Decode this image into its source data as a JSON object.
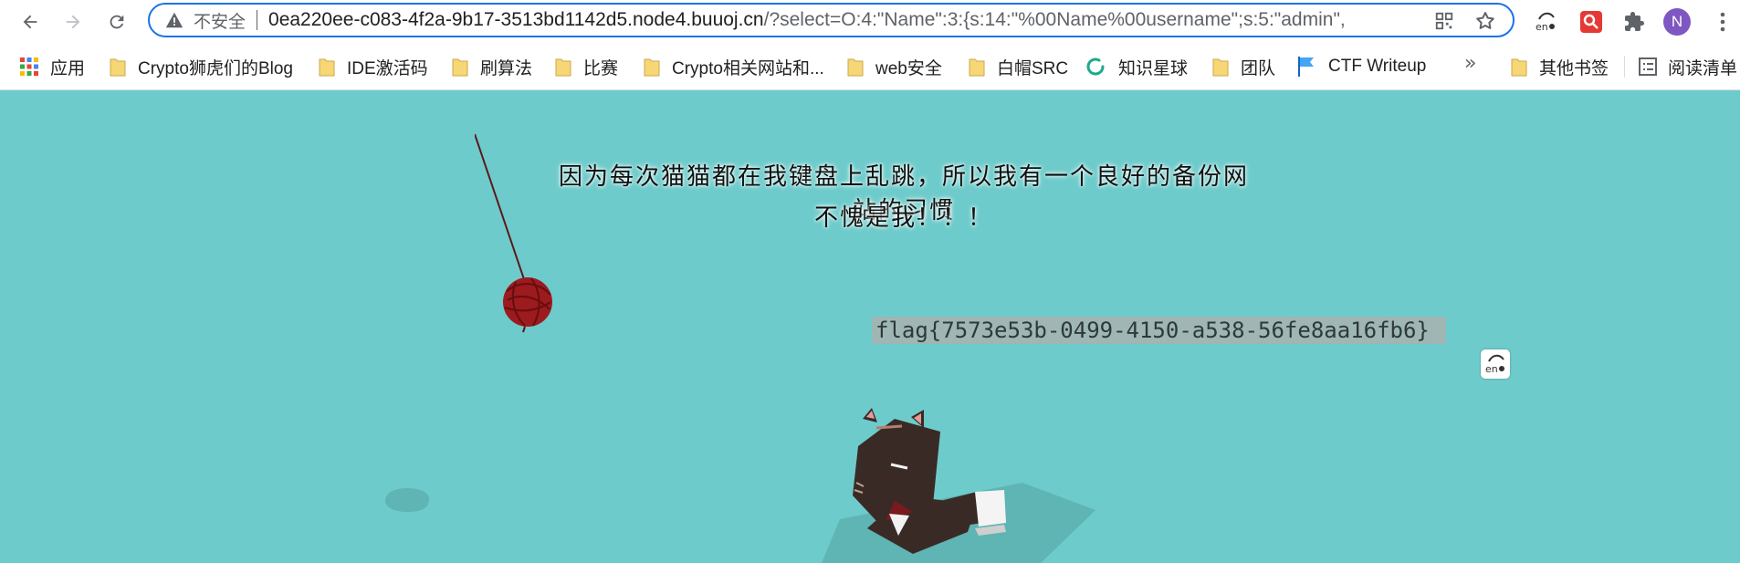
{
  "toolbar": {
    "security_label": "不安全",
    "url_host": "0ea220ee-c083-4f2a-9b17-3513bd1142d5.node4.buuoj.cn",
    "url_path": "/?select=O:4:\"Name\":3:{s:14:\"%00Name%00username\";s:5:\"admin\",",
    "avatar_letter": "N"
  },
  "bookmarks": [
    {
      "label": "应用",
      "icon": "apps-grid-icon"
    },
    {
      "label": "Crypto狮虎们的Blog",
      "icon": "folder-icon"
    },
    {
      "label": "IDE激活码",
      "icon": "folder-icon"
    },
    {
      "label": "刷算法",
      "icon": "folder-icon"
    },
    {
      "label": "比赛",
      "icon": "folder-icon"
    },
    {
      "label": "Crypto相关网站和...",
      "icon": "folder-icon"
    },
    {
      "label": "web安全",
      "icon": "folder-icon"
    },
    {
      "label": "白帽SRC",
      "icon": "folder-icon"
    },
    {
      "label": "知识星球",
      "icon": "zsxq-icon"
    },
    {
      "label": "团队",
      "icon": "folder-icon"
    },
    {
      "label": "CTF Writeup",
      "icon": "flag-icon"
    }
  ],
  "bookmarks_more": "»",
  "other_bookmarks": "其他书签",
  "reading_list": "阅读清单",
  "page": {
    "message_line1": "因为每次猫猫都在我键盘上乱跳，所以我有一个良好的备份网站的习惯",
    "message_line2": "不愧是我！！！",
    "flag": "flag{7573e53b-0499-4150-a538-56fe8aa16fb6}"
  },
  "colors": {
    "page_background": "#6ecbcb",
    "omnibox_border": "#1a73e8",
    "yarn_ball": "#9b1b1e",
    "cat_body": "#3a2a26"
  }
}
